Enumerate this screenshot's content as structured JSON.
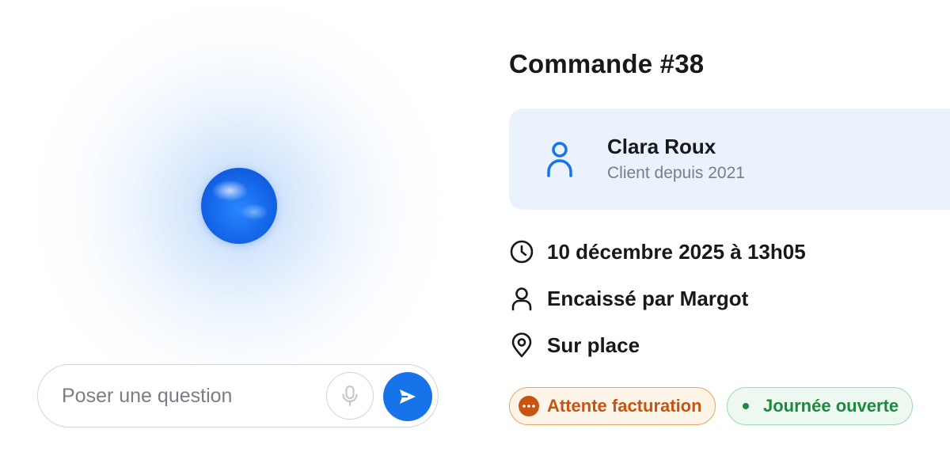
{
  "assistant": {
    "prompt_placeholder": "Poser une question",
    "mic_icon": "mic-icon",
    "send_icon": "send-icon",
    "accent_color": "#1673ea"
  },
  "order": {
    "title": "Commande #38",
    "customer": {
      "name": "Clara Roux",
      "since": "Client depuis 2021",
      "icon": "user-icon"
    },
    "details": [
      {
        "icon": "clock-icon",
        "text": "10 décembre 2025 à 13h05"
      },
      {
        "icon": "person-icon",
        "text": "Encaissé par Margot"
      },
      {
        "icon": "location-pin-icon",
        "text": "Sur place"
      }
    ],
    "badges": [
      {
        "label": "Attente facturation",
        "icon": "more-dots-icon",
        "color": "#c75410",
        "background": "#fff4e8"
      },
      {
        "label": "Journée ouverte",
        "icon": "status-dot-icon",
        "color": "#1b8a41",
        "background": "#ecf8f0"
      }
    ]
  }
}
